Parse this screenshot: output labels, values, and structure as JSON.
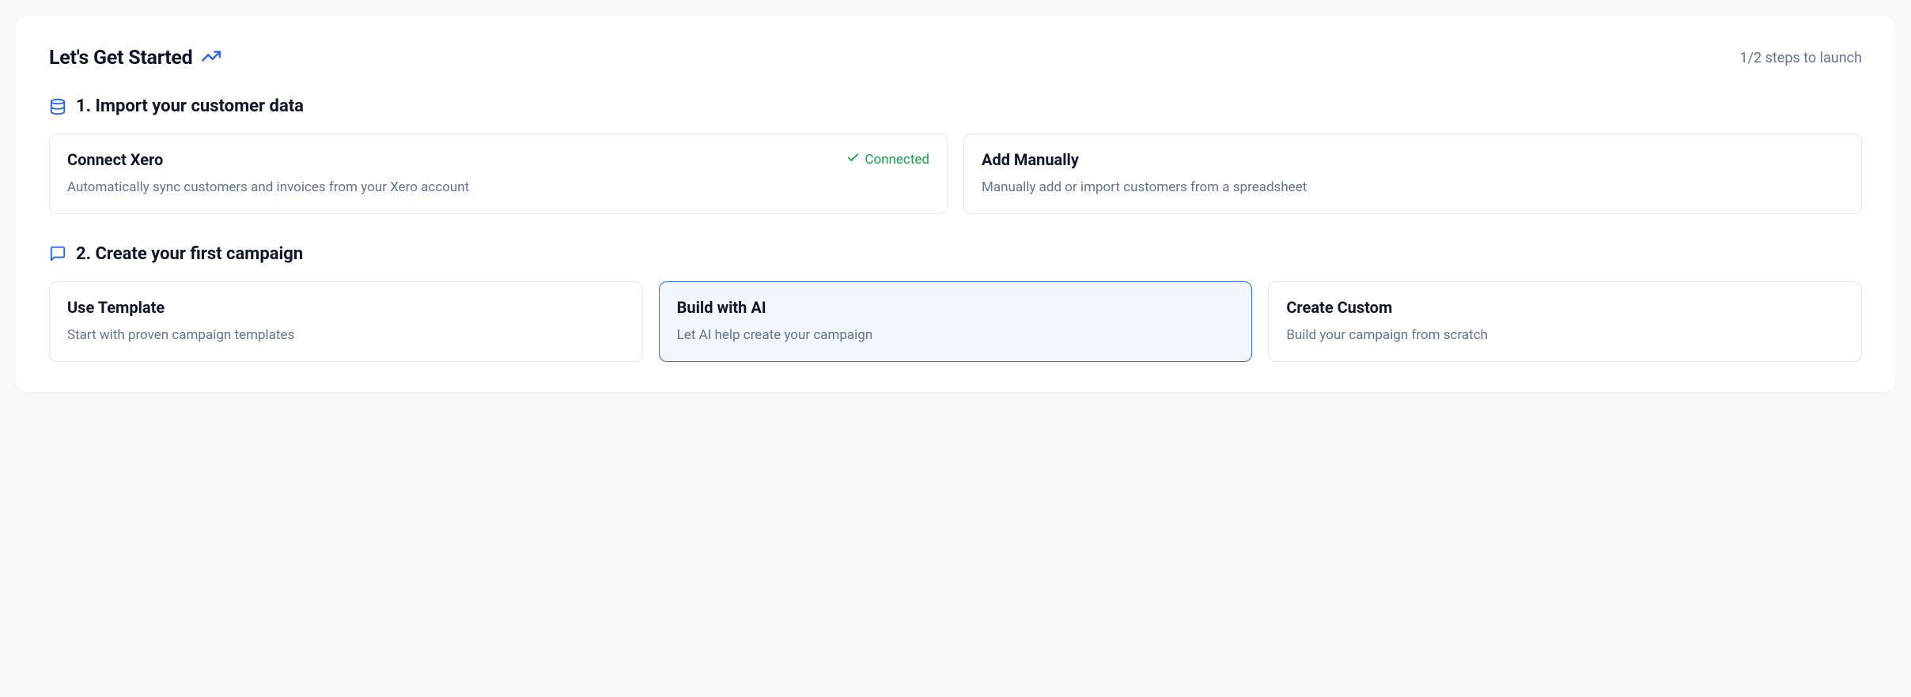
{
  "header": {
    "title": "Let's Get Started",
    "steps_text": "1/2 steps to launch"
  },
  "sections": {
    "import": {
      "title": "1. Import your customer data",
      "cards": {
        "xero": {
          "title": "Connect Xero",
          "desc": "Automatically sync customers and invoices from your Xero account",
          "status": "Connected"
        },
        "manual": {
          "title": "Add Manually",
          "desc": "Manually add or import customers from a spreadsheet"
        }
      }
    },
    "campaign": {
      "title": "2. Create your first campaign",
      "cards": {
        "template": {
          "title": "Use Template",
          "desc": "Start with proven campaign templates"
        },
        "ai": {
          "title": "Build with AI",
          "desc": "Let AI help create your campaign"
        },
        "custom": {
          "title": "Create Custom",
          "desc": "Build your campaign from scratch"
        }
      }
    }
  }
}
